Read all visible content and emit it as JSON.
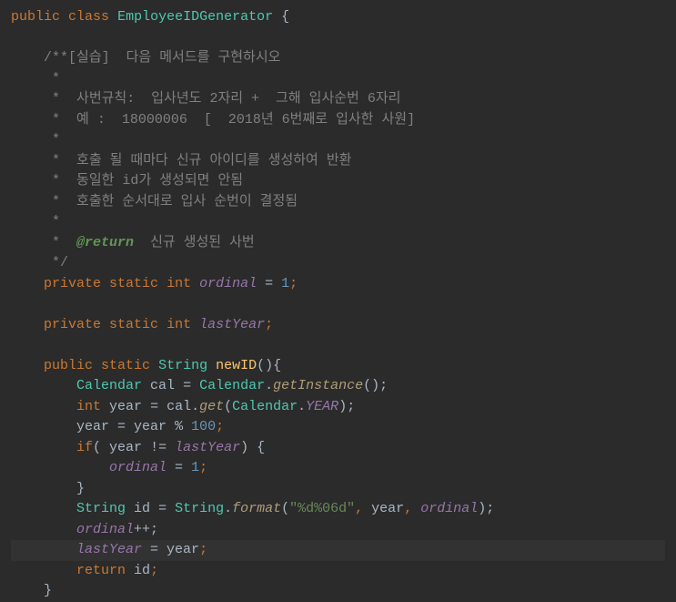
{
  "code": {
    "class_decl": {
      "public": "public",
      "class": "class",
      "name": "EmployeeIDGenerator",
      "brace": "{"
    },
    "doc": {
      "open": "/**",
      "l1": "[실습]  다음 메서드를 구현하시오",
      "star": " *",
      "l2": "  사번규칙:  입사년도 2자리 +  그해 입사순번 6자리",
      "l3": "  예 :  18000006  [  2018년 6번째로 입사한 사원]",
      "l4": "  호출 될 때마다 신규 아이디를 생성하여 반환",
      "l5": "  동일한 id가 생성되면 안됨",
      "l6": "  호출한 순서대로 입사 순번이 결정됨",
      "ret_tag": "@return",
      "ret_desc": "  신규 생성된 사번",
      "close": " */"
    },
    "field1": {
      "private": "private",
      "static": "static",
      "int": "int",
      "name": "ordinal",
      "eq": " = ",
      "val": "1",
      "semi": ";"
    },
    "field2": {
      "private": "private",
      "static": "static",
      "int": "int",
      "name": "lastYear",
      "semi": ";"
    },
    "method": {
      "public": "public",
      "static": "static",
      "ret": "String",
      "name": "newID",
      "parens": "(){",
      "l1_type": "Calendar",
      "l1_var": "cal",
      "l1_eq": " = ",
      "l1_type2": "Calendar",
      "l1_dot": ".",
      "l1_m": "getInstance",
      "l1_p": "();",
      "l2_int": "int",
      "l2_var": "year",
      "l2_eq": " = ",
      "l2_cal": "cal",
      "l2_dot": ".",
      "l2_m": "get",
      "l2_po": "(",
      "l2_cal2": "Calendar",
      "l2_dot2": ".",
      "l2_f": "YEAR",
      "l2_pc": ");",
      "l3_var": "year",
      "l3_eq": " = ",
      "l3_v2": "year",
      "l3_op": " % ",
      "l3_n": "100",
      "l3_s": ";",
      "l4_if": "if",
      "l4_po": "( ",
      "l4_v": "year",
      "l4_ne": " != ",
      "l4_f": "lastYear",
      "l4_pc": ") {",
      "l5_f": "ordinal",
      "l5_eq": " = ",
      "l5_n": "1",
      "l5_s": ";",
      "l6_b": "}",
      "l7_t": "String",
      "l7_v": "id",
      "l7_eq": " = ",
      "l7_t2": "String",
      "l7_dot": ".",
      "l7_m": "format",
      "l7_po": "(",
      "l7_str": "\"%d%06d\"",
      "l7_c1": ", ",
      "l7_a1": "year",
      "l7_c2": ", ",
      "l7_a2": "ordinal",
      "l7_pc": ");",
      "l8_f": "ordinal",
      "l8_op": "++;",
      "l9_f": "lastYear",
      "l9_eq": " = ",
      "l9_v": "year",
      "l9_s": ";",
      "l10_ret": "return",
      "l10_v": "id",
      "l10_s": ";",
      "close": "}"
    }
  }
}
